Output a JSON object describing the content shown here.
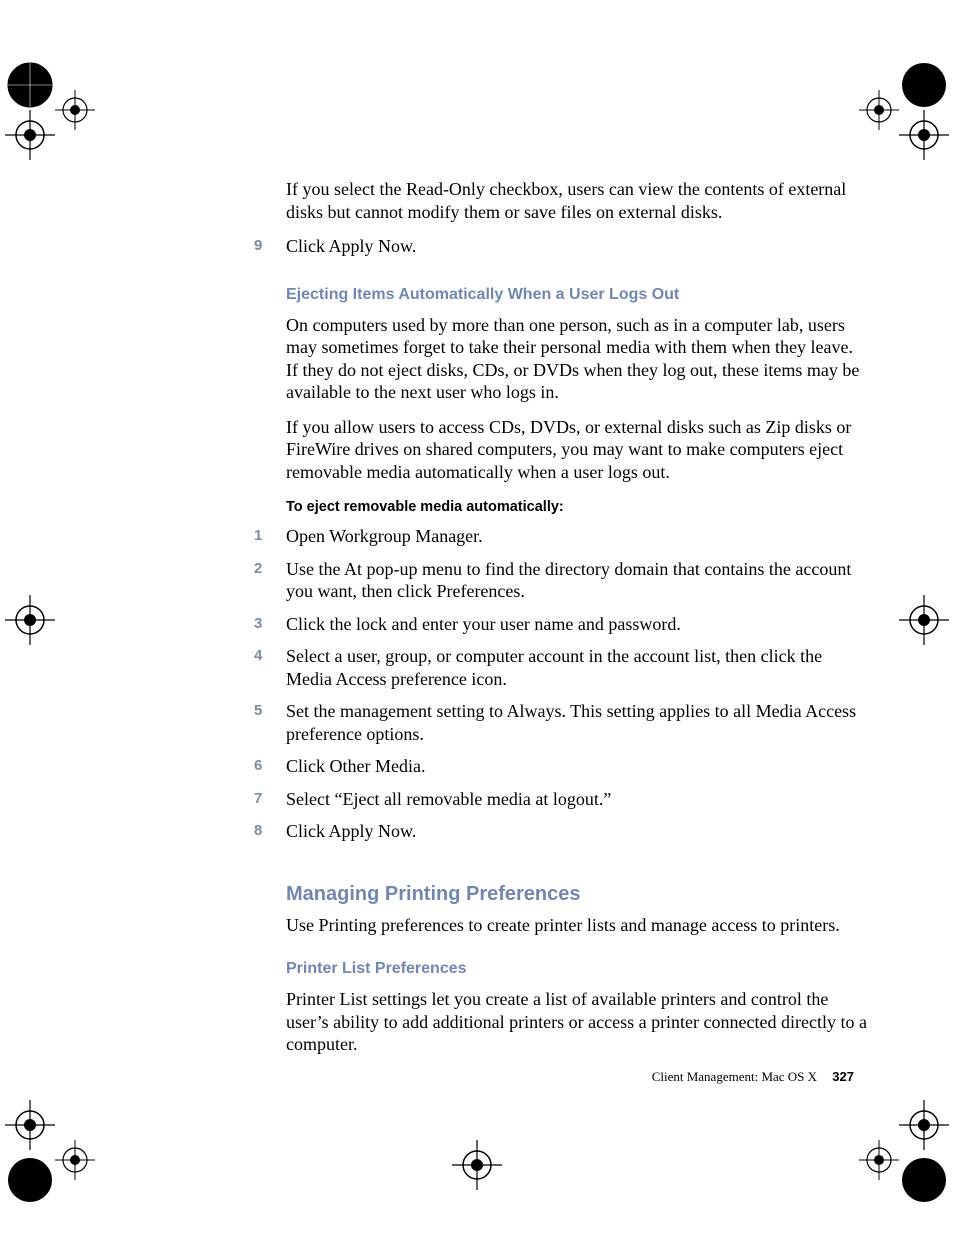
{
  "intro_p1": "If you select the Read-Only checkbox, users can view the contents of external disks but cannot modify them or save files on external disks.",
  "step9": {
    "num": "9",
    "text": "Click Apply Now."
  },
  "heading_eject": "Ejecting Items Automatically When a User Logs Out",
  "eject_p1": "On computers used by more than one person, such as in a computer lab, users may sometimes forget to take their personal media with them when they leave. If they do not eject disks, CDs, or DVDs when they log out, these items may be available to the next user who logs in.",
  "eject_p2": "If you allow users to access CDs, DVDs, or external disks such as Zip disks or FireWire drives on shared computers, you may want to make computers eject removable media automatically when a user logs out.",
  "heading_procedure": "To eject removable media automatically:",
  "steps": [
    {
      "num": "1",
      "text": "Open Workgroup Manager."
    },
    {
      "num": "2",
      "text": "Use the At pop-up menu to find the directory domain that contains the account you want, then click Preferences."
    },
    {
      "num": "3",
      "text": "Click the lock and enter your user name and password."
    },
    {
      "num": "4",
      "text": "Select a user, group, or computer account in the account list, then click the Media Access preference icon."
    },
    {
      "num": "5",
      "text": "Set the management setting to Always. This setting applies to all Media Access preference options."
    },
    {
      "num": "6",
      "text": "Click Other Media."
    },
    {
      "num": "7",
      "text": "Select “Eject all removable media at logout.”"
    },
    {
      "num": "8",
      "text": "Click Apply Now."
    }
  ],
  "heading_printing": "Managing Printing Preferences",
  "printing_p1": "Use Printing preferences to create printer lists and manage access to printers.",
  "heading_printerlist": "Printer List Preferences",
  "printerlist_p1": "Printer List settings let you create a list of available printers and control the user’s ability to add additional printers or access a printer connected directly to a computer.",
  "footer_text": "Client Management: Mac OS X",
  "page_number": "327"
}
